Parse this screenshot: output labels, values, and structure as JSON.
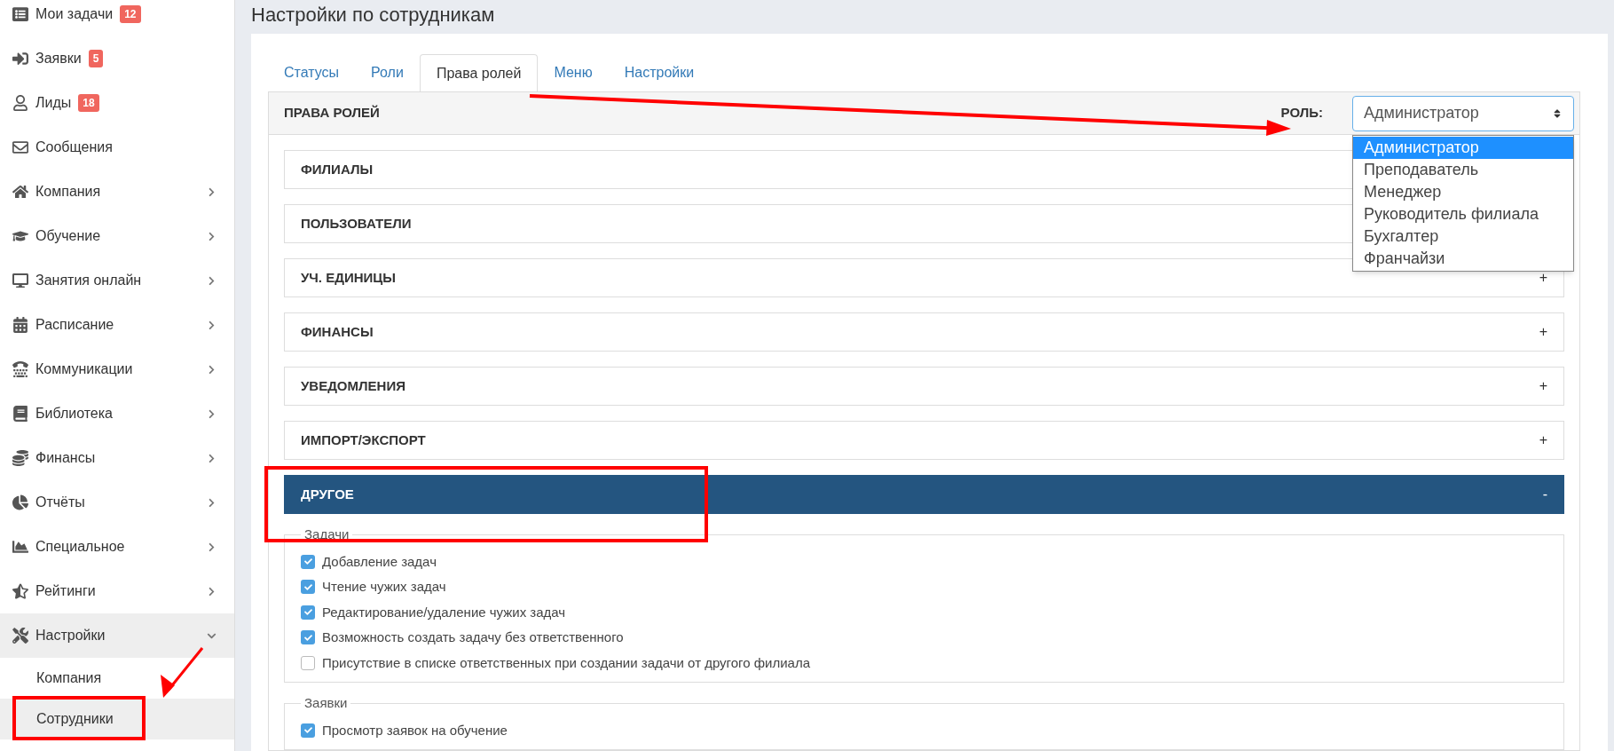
{
  "sidebar": {
    "items": [
      {
        "label": "Мои задачи",
        "kind": "link",
        "badge": "12"
      },
      {
        "label": "Заявки",
        "kind": "link",
        "badge": "5"
      },
      {
        "label": "Лиды",
        "kind": "link",
        "badge": "18"
      },
      {
        "label": "Сообщения",
        "kind": "link"
      },
      {
        "label": "Компания",
        "kind": "group",
        "expanded": false
      },
      {
        "label": "Обучение",
        "kind": "group",
        "expanded": false
      },
      {
        "label": "Занятия онлайн",
        "kind": "group",
        "expanded": false
      },
      {
        "label": "Расписание",
        "kind": "group",
        "expanded": false
      },
      {
        "label": "Коммуникации",
        "kind": "group",
        "expanded": false
      },
      {
        "label": "Библиотека",
        "kind": "group",
        "expanded": false
      },
      {
        "label": "Финансы",
        "kind": "group",
        "expanded": false
      },
      {
        "label": "Отчёты",
        "kind": "group",
        "expanded": false
      },
      {
        "label": "Специальное",
        "kind": "group",
        "expanded": false
      },
      {
        "label": "Рейтинги",
        "kind": "group",
        "expanded": false
      },
      {
        "label": "Настройки",
        "kind": "group",
        "expanded": true,
        "children": [
          {
            "label": "Компания",
            "selected": false
          },
          {
            "label": "Сотрудники",
            "selected": true
          }
        ]
      }
    ]
  },
  "page": {
    "title": "Настройки по сотрудникам"
  },
  "tabs": [
    {
      "label": "Статусы",
      "selected": false
    },
    {
      "label": "Роли",
      "selected": false
    },
    {
      "label": "Права ролей",
      "selected": true
    },
    {
      "label": "Меню",
      "selected": false
    },
    {
      "label": "Настройки",
      "selected": false
    }
  ],
  "panel": {
    "title": "ПРАВА РОЛЕЙ",
    "role_label": "РОЛЬ:",
    "role_select": {
      "value": "Администратор",
      "open": true,
      "options": [
        {
          "label": "Администратор",
          "selected": true
        },
        {
          "label": "Преподаватель",
          "selected": false
        },
        {
          "label": "Менеджер",
          "selected": false
        },
        {
          "label": "Руководитель филиала",
          "selected": false
        },
        {
          "label": "Бухгалтер",
          "selected": false
        },
        {
          "label": "Франчайзи",
          "selected": false
        }
      ]
    }
  },
  "sections": [
    {
      "title": "ФИЛИАЛЫ",
      "expanded": false
    },
    {
      "title": "ПОЛЬЗОВАТЕЛИ",
      "expanded": false
    },
    {
      "title": "УЧ. ЕДИНИЦЫ",
      "expanded": false,
      "toggle": "+"
    },
    {
      "title": "ФИНАНСЫ",
      "expanded": false,
      "toggle": "+"
    },
    {
      "title": "УВЕДОМЛЕНИЯ",
      "expanded": false,
      "toggle": "+"
    },
    {
      "title": "ИМПОРТ/ЭКСПОРТ",
      "expanded": false,
      "toggle": "+"
    },
    {
      "title": "ДРУГОЕ",
      "expanded": true,
      "toggle": "-",
      "groups": [
        {
          "legend": "Задачи",
          "options": [
            {
              "label": "Добавление задач",
              "checked": true
            },
            {
              "label": "Чтение чужих задач",
              "checked": true
            },
            {
              "label": "Редактирование/удаление чужих задач",
              "checked": true
            },
            {
              "label": "Возможность создать задачу без ответственного",
              "checked": true
            },
            {
              "label": "Присутствие в списке ответственных при создании задачи от другого филиала",
              "checked": false
            }
          ]
        },
        {
          "legend": "Заявки",
          "options": [
            {
              "label": "Просмотр заявок на обучение",
              "checked": true
            }
          ]
        }
      ]
    }
  ]
}
